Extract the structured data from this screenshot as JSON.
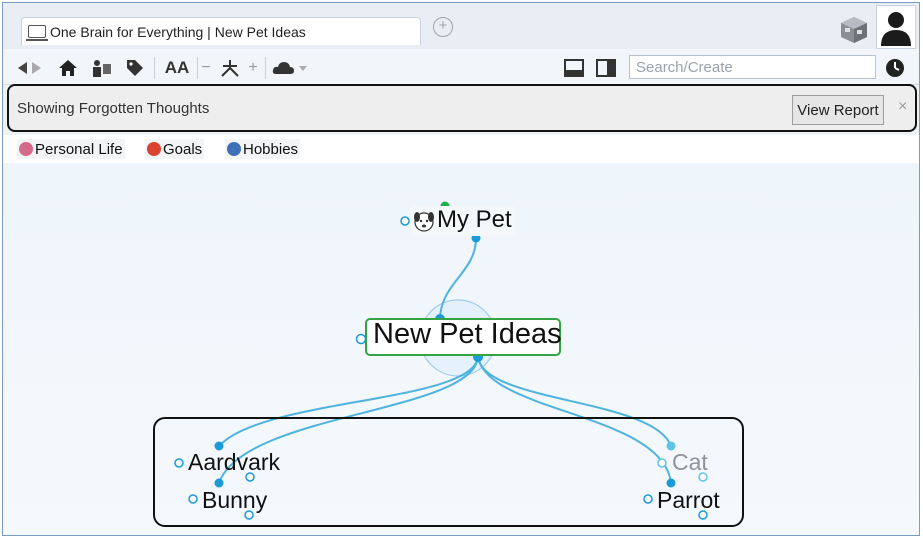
{
  "tab": {
    "title": "One Brain for Everything | New Pet Ideas"
  },
  "toolbar": {
    "icons": [
      "back-icon",
      "forward-icon",
      "home-icon",
      "thought-type-icon",
      "tag-icon",
      "font-size-icon",
      "zoom-out-icon",
      "layout-icon",
      "zoom-in-icon",
      "cloud-sync-icon"
    ],
    "font_label": "AA",
    "search_placeholder": "Search/Create"
  },
  "notice": {
    "text": "Showing Forgotten Thoughts",
    "button_label": "View Report",
    "close_label": "×"
  },
  "tags": [
    {
      "label": "Personal Life",
      "color": "#d46a8a"
    },
    {
      "label": "Goals",
      "color": "#d9432f"
    },
    {
      "label": "Hobbies",
      "color": "#3f6fb5"
    }
  ],
  "map": {
    "parent": {
      "label": "My Pet"
    },
    "active": {
      "label": "New Pet Ideas"
    },
    "children": [
      {
        "label": "Aardvark"
      },
      {
        "label": "Bunny"
      },
      {
        "label": "Cat"
      },
      {
        "label": "Parrot"
      }
    ],
    "colors": {
      "link": "#4fb3dd",
      "active_border": "#33a344",
      "dot": "#1a9ad6",
      "parent_dot": "#22b04a"
    }
  }
}
